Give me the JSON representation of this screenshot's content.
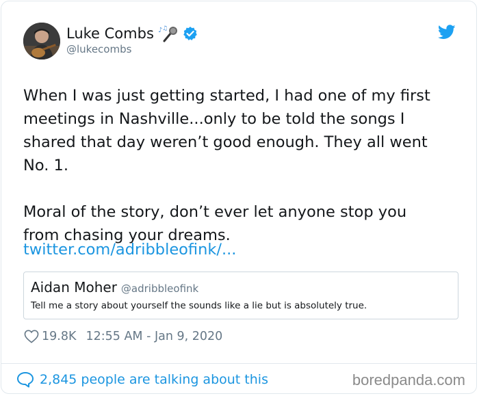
{
  "author": {
    "display_name": "Luke Combs",
    "handle": "@lukecombs",
    "verified": true,
    "name_emoji": "microphone-with-music-notes"
  },
  "tweet": {
    "text": "When I was just getting started, I had one of my first\nmeetings in Nashville...only to be told the songs I\nshared that day weren’t good enough. They all went\nNo. 1.\n\nMoral of the story, don’t ever let anyone stop you\nfrom chasing your dreams.",
    "link_text": "twitter.com/adribbleofink/..."
  },
  "quoted_tweet": {
    "display_name": "Aidan Moher",
    "handle": "@adribbleofink",
    "text": "Tell me a story about yourself the sounds like a lie but is absolutely true."
  },
  "meta": {
    "likes": "19.8K",
    "timestamp": "12:55 AM - Jan 9, 2020"
  },
  "footer": {
    "talking_text": "2,845 people are talking about this",
    "watermark": "boredpanda.com"
  },
  "colors": {
    "link": "#1b95e0",
    "secondary_text": "#657786",
    "verified": "#1da1f2"
  }
}
